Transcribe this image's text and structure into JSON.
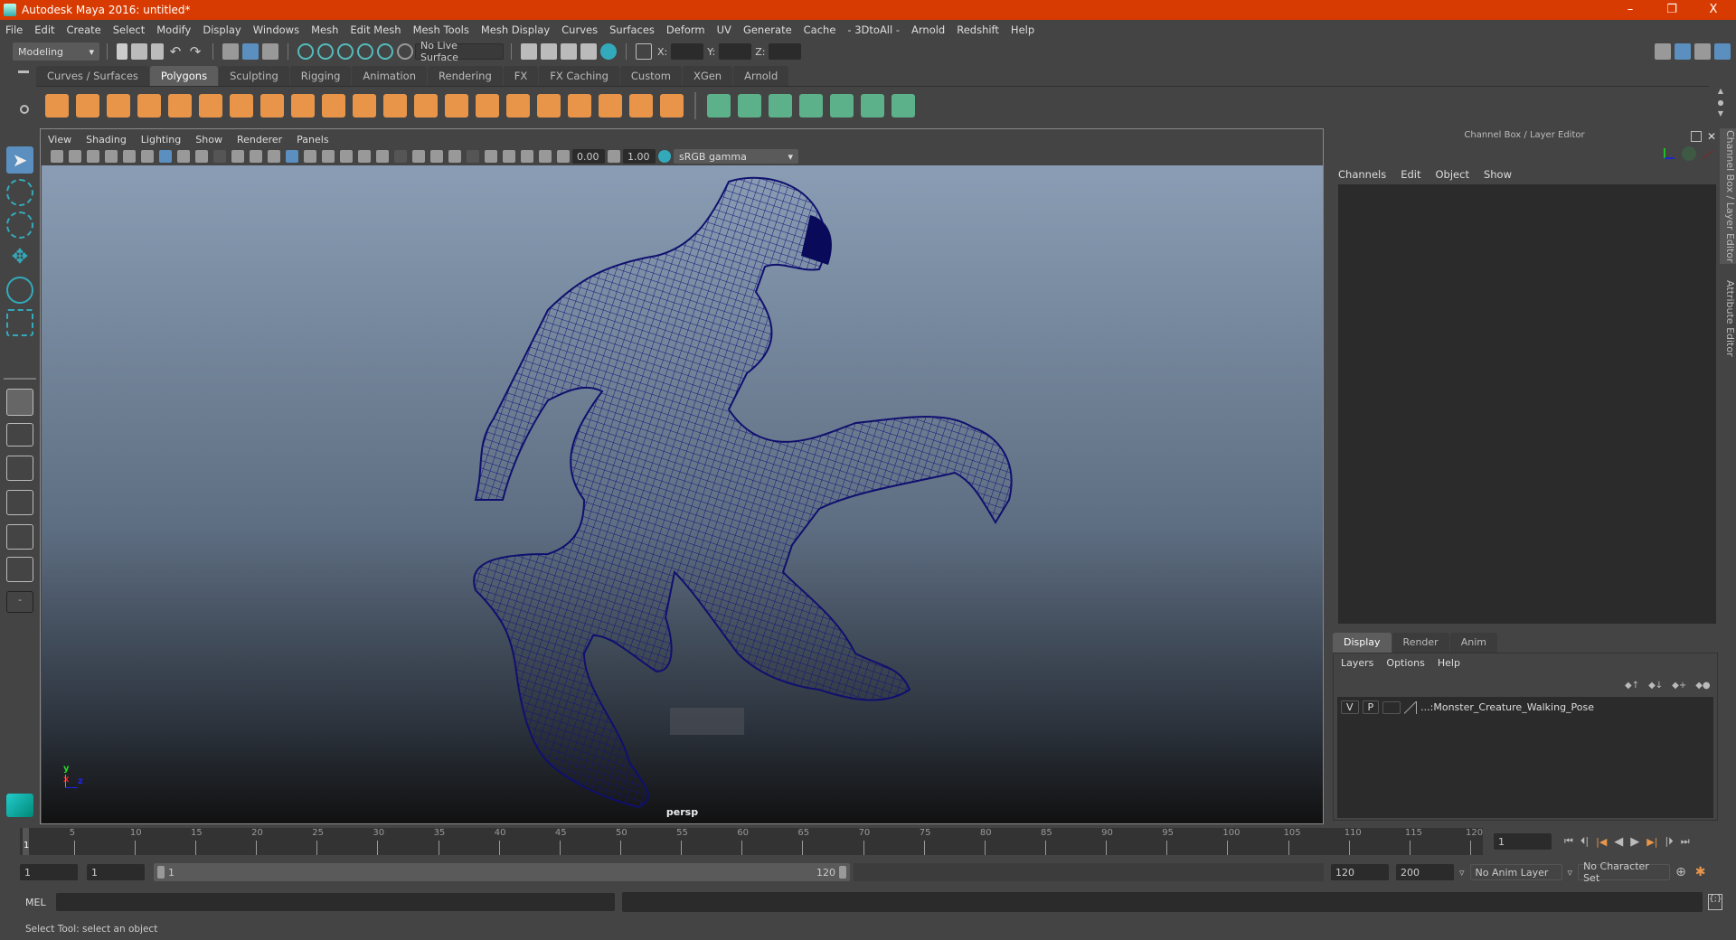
{
  "window": {
    "title": "Autodesk Maya 2016: untitled*",
    "minimize": "–",
    "restore": "❐",
    "close": "X"
  },
  "menubar": [
    "File",
    "Edit",
    "Create",
    "Select",
    "Modify",
    "Display",
    "Windows",
    "Mesh",
    "Edit Mesh",
    "Mesh Tools",
    "Mesh Display",
    "Curves",
    "Surfaces",
    "Deform",
    "UV",
    "Generate",
    "Cache",
    "- 3DtoAll -",
    "Arnold",
    "Redshift",
    "Help"
  ],
  "statusline": {
    "menuset": "Modeling",
    "live_surface": "No Live Surface",
    "x_label": "X:",
    "y_label": "Y:",
    "z_label": "Z:",
    "x": "",
    "y": "",
    "z": ""
  },
  "shelf_tabs": [
    {
      "label": "Curves / Surfaces",
      "active": false
    },
    {
      "label": "Polygons",
      "active": true
    },
    {
      "label": "Sculpting",
      "active": false
    },
    {
      "label": "Rigging",
      "active": false
    },
    {
      "label": "Animation",
      "active": false
    },
    {
      "label": "Rendering",
      "active": false
    },
    {
      "label": "FX",
      "active": false
    },
    {
      "label": "FX Caching",
      "active": false
    },
    {
      "label": "Custom",
      "active": false
    },
    {
      "label": "XGen",
      "active": false
    },
    {
      "label": "Arnold",
      "active": false
    }
  ],
  "shelf_icons": {
    "orange": [
      "poly-sphere",
      "poly-cube",
      "poly-cylinder",
      "poly-cone",
      "poly-plane",
      "poly-torus",
      "poly-pyramid",
      "poly-pipe",
      "combine",
      "separate",
      "extract",
      "smooth",
      "boolean",
      "bridge",
      "multi-cut",
      "extrude",
      "bevel",
      "append",
      "fill-hole",
      "target-weld",
      "mirror"
    ],
    "green": [
      "planar-uv",
      "cylindrical-uv",
      "spherical-uv",
      "automatic-uv",
      "unfold-uv",
      "uv-editor",
      "layout-uv"
    ]
  },
  "viewport": {
    "menus": [
      "View",
      "Shading",
      "Lighting",
      "Show",
      "Renderer",
      "Panels"
    ],
    "exposure": "0.00",
    "gamma": "1.00",
    "color_space": "sRGB gamma",
    "camera": "persp",
    "axis": {
      "x": "x",
      "y": "y",
      "z": "z"
    }
  },
  "channel_box": {
    "title": "Channel Box / Layer Editor",
    "menus": [
      "Channels",
      "Edit",
      "Object",
      "Show"
    ]
  },
  "layer_editor": {
    "tabs": [
      {
        "label": "Display",
        "active": true
      },
      {
        "label": "Render",
        "active": false
      },
      {
        "label": "Anim",
        "active": false
      }
    ],
    "menus": [
      "Layers",
      "Options",
      "Help"
    ],
    "layers": [
      {
        "v": "V",
        "p": "P",
        "name": "...:Monster_Creature_Walking_Pose"
      }
    ]
  },
  "side_tabs": [
    "Channel Box / Layer Editor",
    "Attribute Editor"
  ],
  "timeline": {
    "ticks": [
      5,
      10,
      15,
      20,
      25,
      30,
      35,
      40,
      45,
      50,
      55,
      60,
      65,
      70,
      75,
      80,
      85,
      90,
      95,
      100,
      105,
      110,
      115,
      120
    ],
    "start": 1,
    "end": 120,
    "current": "1",
    "current_frame_field": "1"
  },
  "range": {
    "start": "1",
    "playback_start": "1",
    "slider_start": "1",
    "slider_end": "120",
    "playback_end": "120",
    "end": "200",
    "anim_layer": "No Anim Layer",
    "character_set": "No Character Set"
  },
  "mel": {
    "label": "MEL",
    "command": "",
    "result": ""
  },
  "helpline": "Select Tool: select an object"
}
